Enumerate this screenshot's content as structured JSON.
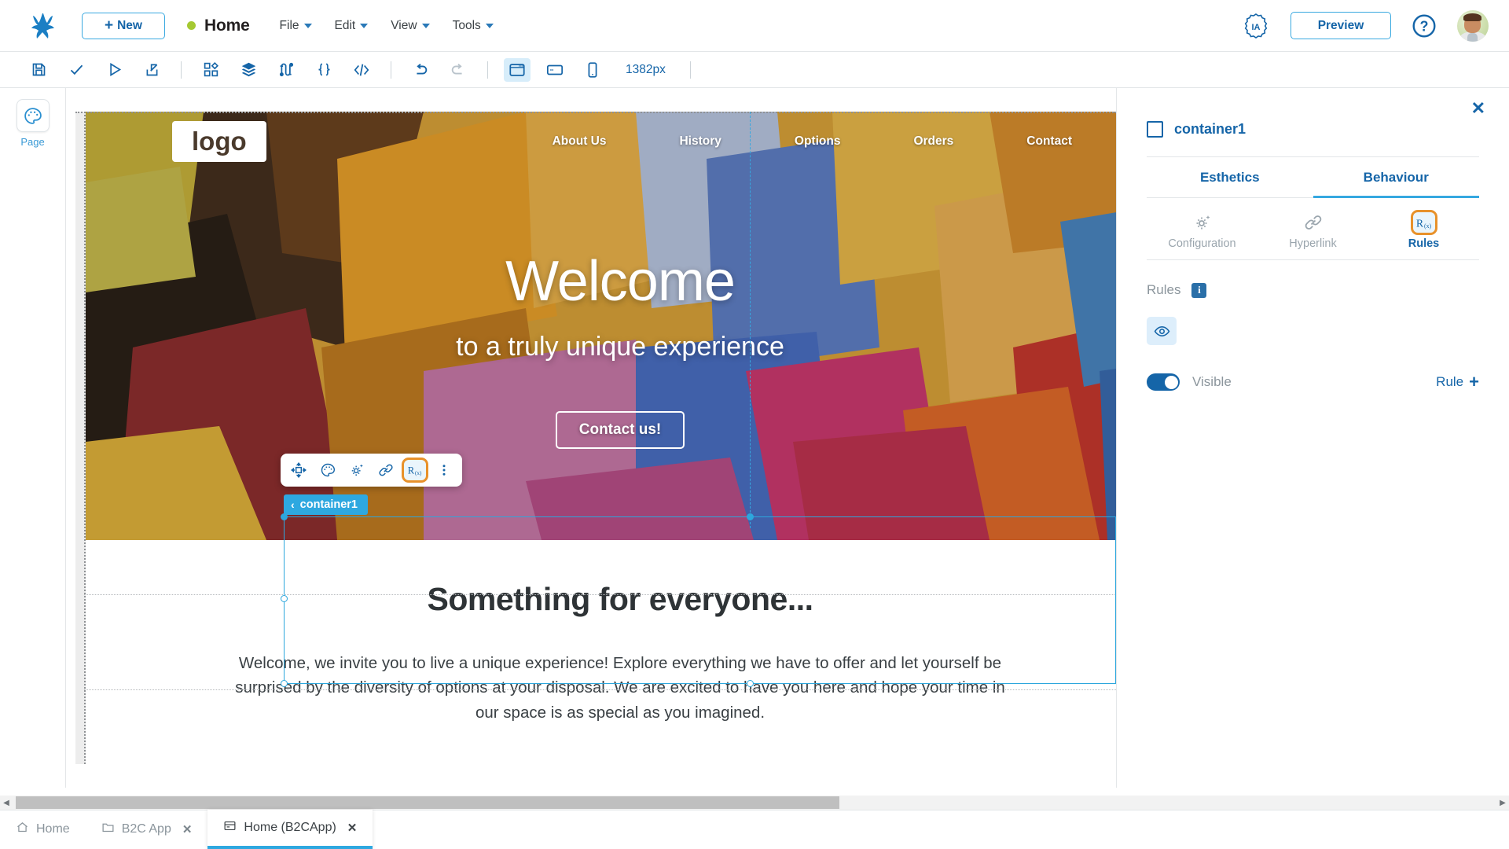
{
  "header": {
    "logo_icon": "frog-logo-icon",
    "new_button": "New",
    "page_title": "Home",
    "status_dot_color": "#a5c932",
    "menus": [
      "File",
      "Edit",
      "View",
      "Tools"
    ],
    "ia_badge": "IA",
    "preview_button": "Preview",
    "help_icon": "question-mark-icon",
    "avatar": "user-avatar"
  },
  "toolbar": {
    "items": [
      {
        "name": "save-icon",
        "state": "enabled"
      },
      {
        "name": "check-icon",
        "state": "enabled"
      },
      {
        "name": "play-icon",
        "state": "enabled"
      },
      {
        "name": "publish-icon",
        "state": "enabled"
      },
      {
        "name": "components-icon",
        "state": "enabled"
      },
      {
        "name": "layers-icon",
        "state": "enabled"
      },
      {
        "name": "flow-icon",
        "state": "enabled"
      },
      {
        "name": "braces-icon",
        "state": "enabled"
      },
      {
        "name": "code-icon",
        "state": "enabled"
      },
      {
        "name": "undo-icon",
        "state": "enabled"
      },
      {
        "name": "redo-icon",
        "state": "disabled"
      },
      {
        "name": "desktop-view-icon",
        "state": "active"
      },
      {
        "name": "tablet-view-icon",
        "state": "enabled"
      },
      {
        "name": "mobile-view-icon",
        "state": "enabled"
      }
    ],
    "viewport_size": "1382px"
  },
  "rail": {
    "items": [
      {
        "icon": "palette-icon",
        "label": "Page"
      }
    ]
  },
  "canvas": {
    "site": {
      "logo": "logo",
      "nav": [
        "About Us",
        "History",
        "Options",
        "Orders",
        "Contact"
      ],
      "hero_title": "Welcome",
      "hero_subtitle": "to a truly unique experience",
      "hero_button": "Contact us!",
      "section_title": "Something for everyone...",
      "section_body": "Welcome, we invite you to live a unique experience! Explore everything we have to offer and let yourself be surprised by the diversity of options at your disposal. We are excited to have you here and hope your time in our space is as special as you imagined."
    },
    "selection": {
      "tag_label": "container1",
      "tag_chevron": "chevron-left-icon"
    },
    "float_tools": [
      {
        "name": "move-icon",
        "highlight": false
      },
      {
        "name": "palette-icon",
        "highlight": false
      },
      {
        "name": "configuration-icon",
        "highlight": false
      },
      {
        "name": "hyperlink-icon",
        "highlight": false
      },
      {
        "name": "rules-icon",
        "highlight": true
      },
      {
        "name": "more-vertical-icon",
        "highlight": false
      }
    ]
  },
  "panel": {
    "close_icon": "close-icon",
    "element_name": "container1",
    "tabs": [
      {
        "label": "Esthetics",
        "active": false
      },
      {
        "label": "Behaviour",
        "active": true
      }
    ],
    "subtabs": [
      {
        "label": "Configuration",
        "icon": "gear-sparkle-icon",
        "active": false
      },
      {
        "label": "Hyperlink",
        "icon": "link-icon",
        "active": false
      },
      {
        "label": "Rules",
        "icon": "rules-icon",
        "active": true
      }
    ],
    "rules_label": "Rules",
    "info_badge": "i",
    "eye_icon": "eye-icon",
    "visible_toggle": {
      "label": "Visible",
      "on": true
    },
    "rule_add": {
      "label": "Rule",
      "icon": "plus-icon"
    }
  },
  "bottom_tabs": [
    {
      "label": "Home",
      "icon": "home-icon",
      "active": false,
      "closable": false
    },
    {
      "label": "B2C App",
      "icon": "folder-icon",
      "active": false,
      "closable": true
    },
    {
      "label": "Home (B2CApp)",
      "icon": "page-icon",
      "active": true,
      "closable": true
    }
  ],
  "colors": {
    "accent_blue": "#1565a8",
    "light_blue": "#35a8e0",
    "highlight_orange": "#e8912a",
    "status_green": "#a5c932"
  }
}
